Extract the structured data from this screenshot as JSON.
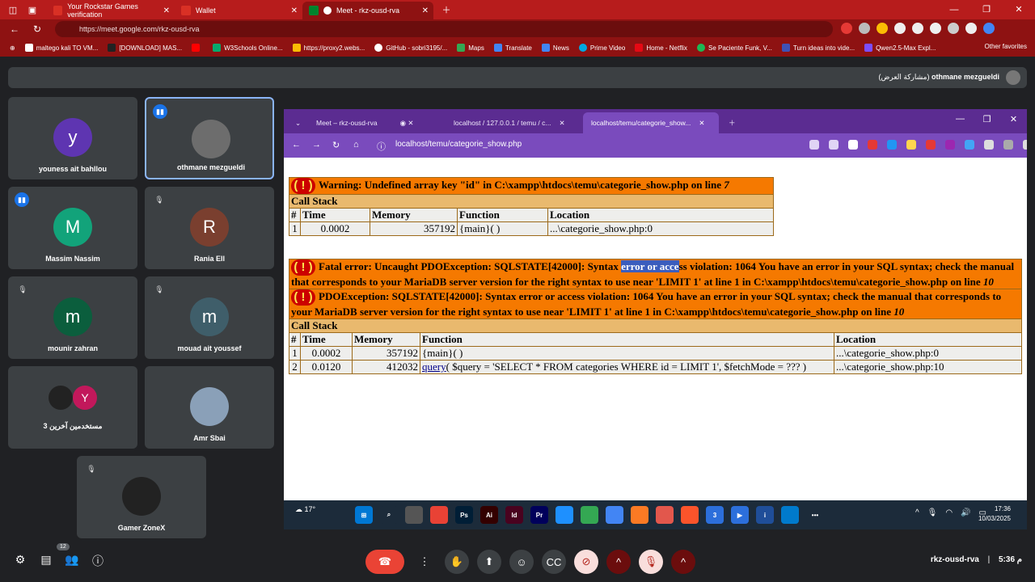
{
  "outer_browser": {
    "tabs": [
      {
        "label": "Your Rockstar Games verification",
        "color": "#d93025"
      },
      {
        "label": "Wallet",
        "color": "#d93025"
      },
      {
        "label": "Meet - rkz-ousd-rva",
        "color": "#00832d"
      }
    ],
    "url": "https://meet.google.com/rkz-ousd-rva",
    "bookmarks": [
      {
        "label": "maltego kali TO VM...",
        "color": "#fff"
      },
      {
        "label": "[DOWNLOAD] MAS...",
        "color": "#222"
      },
      {
        "label": "",
        "color": "#ff0000"
      },
      {
        "label": "W3Schools Online...",
        "color": "#04aa6d"
      },
      {
        "label": "https://proxy2.webs...",
        "color": "#fbbc04"
      },
      {
        "label": "GitHub - sobri3195/...",
        "color": "#fff"
      },
      {
        "label": "Maps",
        "color": "#34a853"
      },
      {
        "label": "Translate",
        "color": "#4285f4"
      },
      {
        "label": "News",
        "color": "#4285f4"
      },
      {
        "label": "Prime Video",
        "color": "#00a8e1"
      },
      {
        "label": "Home - Netflix",
        "color": "#e50914"
      },
      {
        "label": "Se Paciente Funk, V...",
        "color": "#1db954"
      },
      {
        "label": "Turn ideas into vide...",
        "color": "#3f51b5"
      },
      {
        "label": "Qwen2.5-Max Expl...",
        "color": "#7c4dff"
      }
    ],
    "other_favorites": "Other favorites"
  },
  "meet": {
    "presenter_label": "(مشاركة العرض)",
    "presenter_name": "othmane mezgueldi",
    "participants": [
      {
        "initial": "y",
        "name": "youness ait bahllou",
        "color": "#5e35b1"
      },
      {
        "initial": "",
        "name": "othmane mezgueldi",
        "color": "#6d6d6d"
      },
      {
        "initial": "M",
        "name": "Massim Nassim",
        "color": "#12a37a"
      },
      {
        "initial": "R",
        "name": "Rania Ell",
        "color": "#7a3f2f"
      },
      {
        "initial": "m",
        "name": "mounir zahran",
        "color": "#0b5e3d"
      },
      {
        "initial": "m",
        "name": "mouad ait youssef",
        "color": "#3f5e6a"
      },
      {
        "initial": "Y",
        "name": "3 مستخدمين آخرين",
        "color": "#c2185b"
      },
      {
        "initial": "",
        "name": "Amr Sbai",
        "color": "#8aa0b8"
      },
      {
        "initial": "",
        "name": "Gamer ZoneX",
        "color": "#222"
      }
    ],
    "people_count": "12",
    "meeting_code": "rkz-ousd-rva",
    "time": "5:36 م"
  },
  "inner_browser": {
    "tabs": [
      {
        "label": "Meet – rkz-ousd-rva"
      },
      {
        "label": "localhost / 127.0.0.1 / temu / c..."
      },
      {
        "label": "localhost/temu/categorie_show..."
      }
    ],
    "url": "localhost/temu/categorie_show.php"
  },
  "warning": {
    "message": "Warning: Undefined array key \"id\" in C:\\xampp\\htdocs\\temu\\categorie_show.php on line ",
    "line": "7",
    "call_stack": "Call Stack",
    "headers": [
      "#",
      "Time",
      "Memory",
      "Function",
      "Location"
    ],
    "rows": [
      {
        "n": "1",
        "time": "0.0002",
        "memory": "357192",
        "function": "{main}( )",
        "location": "...\\categorie_show.php:0"
      }
    ]
  },
  "fatal": {
    "pre": "Fatal error: Uncaught PDOException: SQLSTATE[42000]: Syntax ",
    "selected": "error or acce",
    "post": "ss violation: 1064 You have an error in your SQL syntax; check the manual that corresponds to your MariaDB server version for the right syntax to use near 'LIMIT 1' at line 1 in C:\\xampp\\htdocs\\temu\\categorie_show.php on line ",
    "line": "10",
    "pdo": "PDOException: SQLSTATE[42000]: Syntax error or access violation: 1064 You have an error in your SQL syntax; check the manual that corresponds to your MariaDB server version for the right syntax to use near 'LIMIT 1' at line 1 in C:\\xampp\\htdocs\\temu\\categorie_show.php on line ",
    "pdo_line": "10",
    "call_stack": "Call Stack",
    "headers": [
      "#",
      "Time",
      "Memory",
      "Function",
      "Location"
    ],
    "rows": [
      {
        "n": "1",
        "time": "0.0002",
        "memory": "357192",
        "function": "{main}( )",
        "location": "...\\categorie_show.php:0"
      },
      {
        "n": "2",
        "time": "0.0120",
        "memory": "412032",
        "fn_link": "query",
        "function": "( $query = 'SELECT * FROM categories WHERE id = LIMIT 1', $fetchMode = ??? )",
        "location": "...\\categorie_show.php:10"
      }
    ]
  },
  "taskbar": {
    "temp": "17°",
    "apps": [
      {
        "label": "",
        "color": "#0078d4"
      },
      {
        "label": "",
        "color": "#1c2b3a"
      },
      {
        "label": "",
        "color": "#555"
      },
      {
        "label": "",
        "color": "#e94235"
      },
      {
        "label": "Ps",
        "color": "#001e36"
      },
      {
        "label": "Ai",
        "color": "#330000"
      },
      {
        "label": "Id",
        "color": "#49021f"
      },
      {
        "label": "Pr",
        "color": "#00005b"
      },
      {
        "label": "",
        "color": "#1e90ff"
      },
      {
        "label": "",
        "color": "#34a853"
      },
      {
        "label": "",
        "color": "#4285f4"
      },
      {
        "label": "",
        "color": "#fb7a24"
      },
      {
        "label": "",
        "color": "#e2574c"
      },
      {
        "label": "",
        "color": "#fb542b"
      },
      {
        "label": "3",
        "color": "#2c6fdb"
      },
      {
        "label": "",
        "color": "#2c6fdb"
      },
      {
        "label": "i",
        "color": "#1f4e99"
      },
      {
        "label": "",
        "color": "#007acc"
      }
    ],
    "time": "17:36",
    "date": "10/03/2025"
  }
}
